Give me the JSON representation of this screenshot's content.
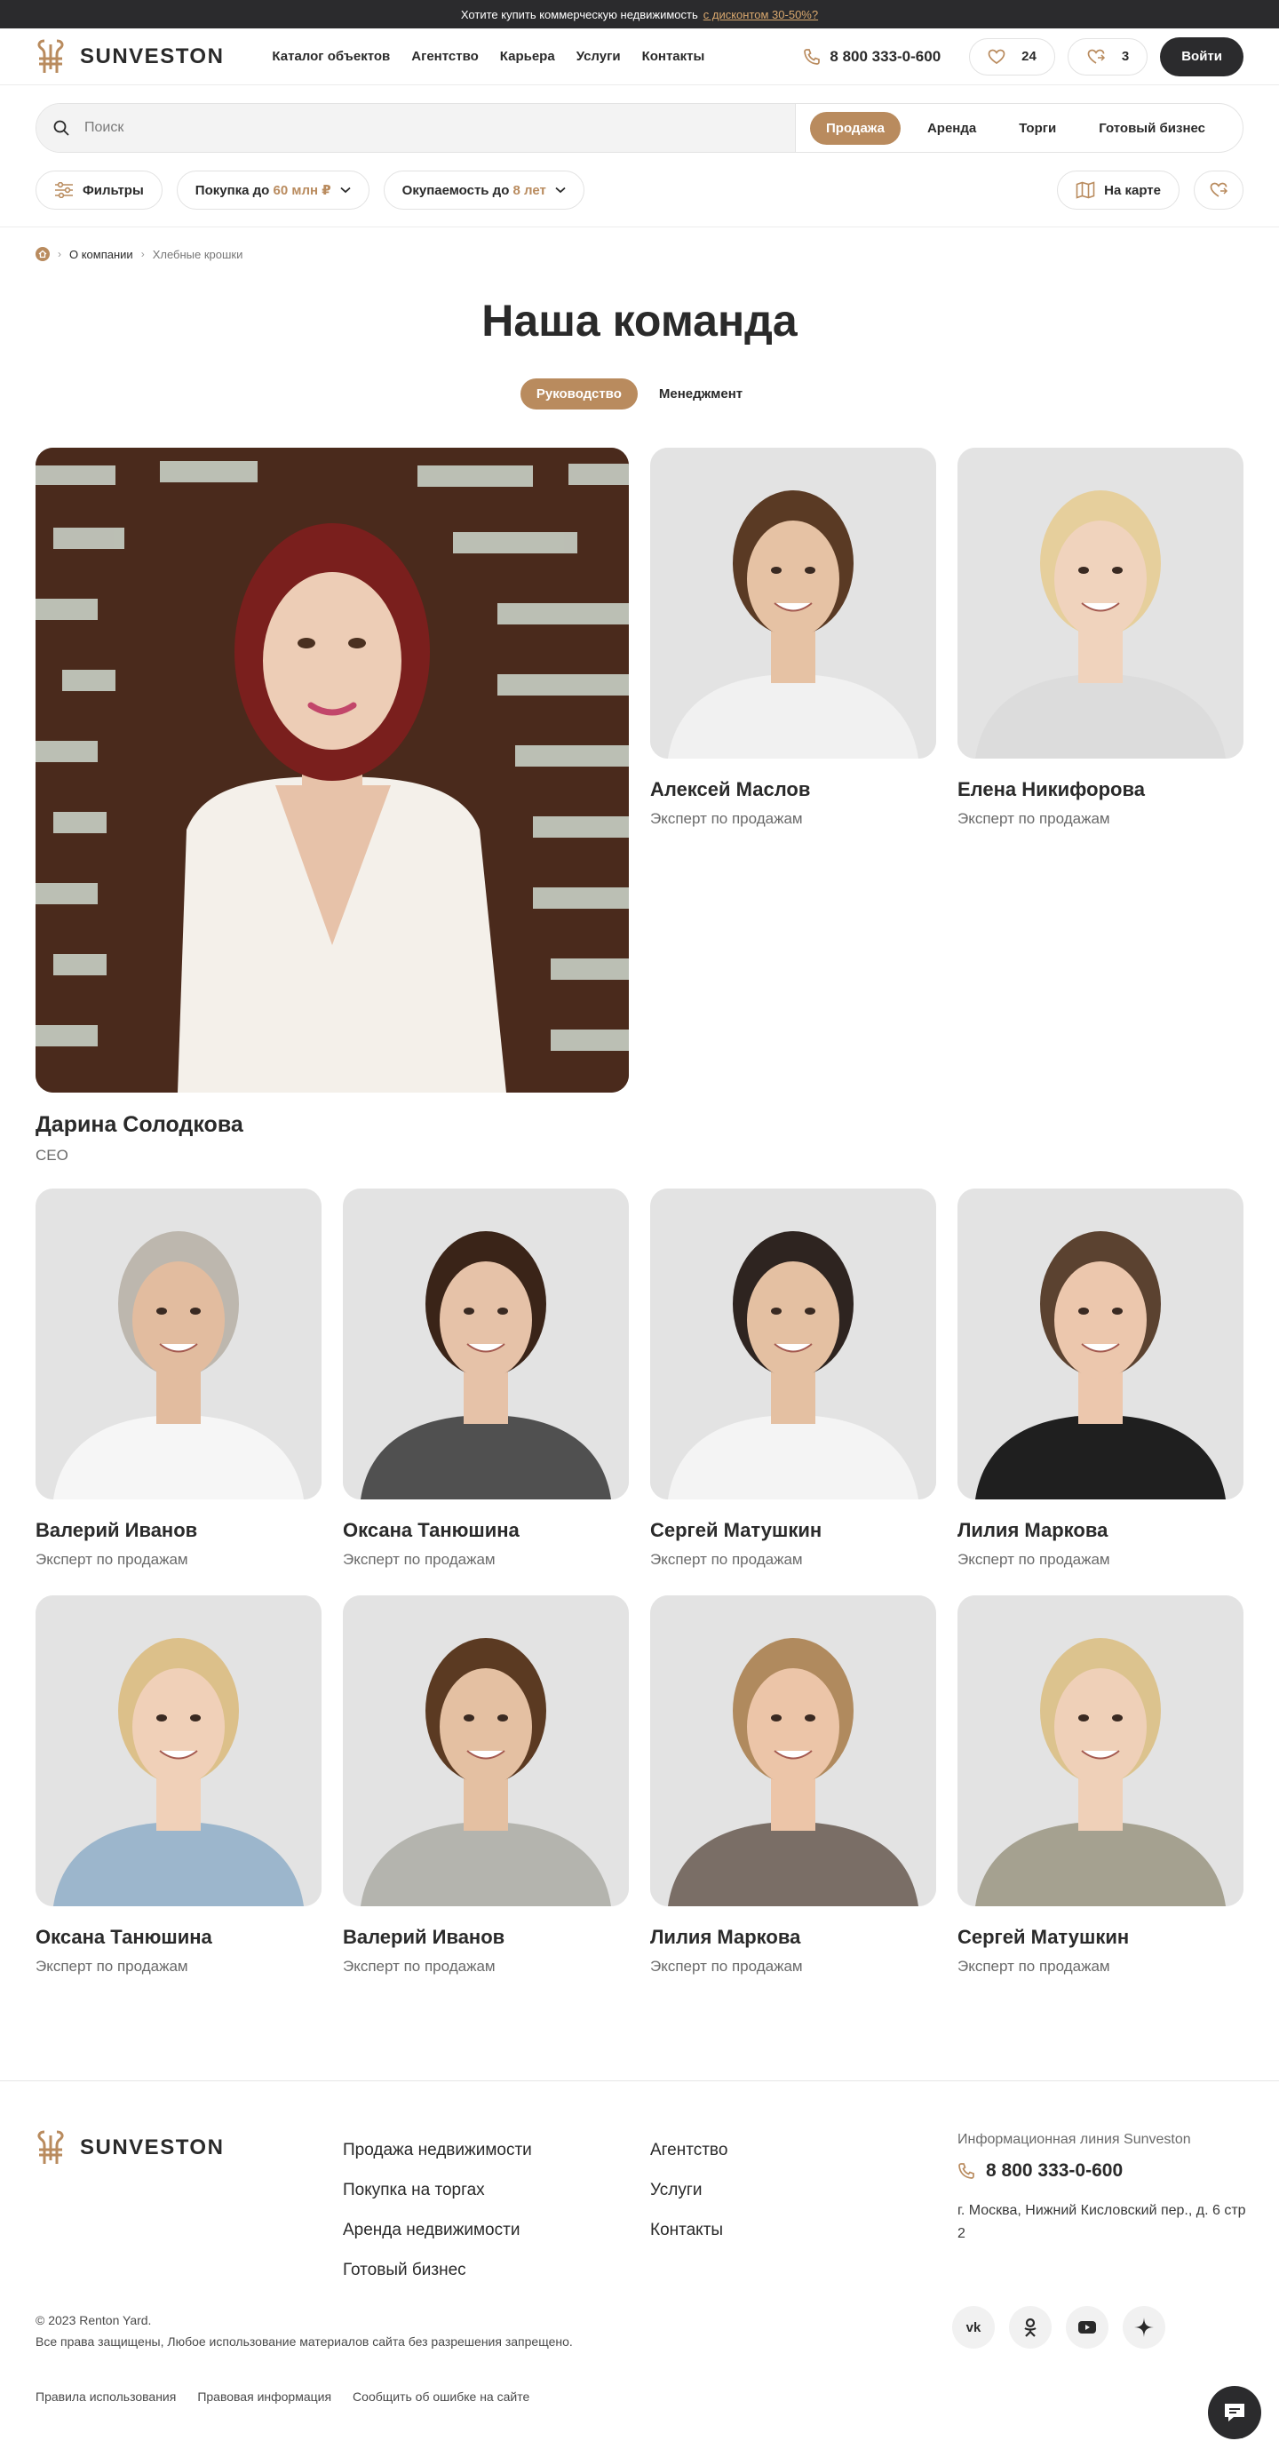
{
  "promo": {
    "text": "Хотите купить коммерческую недвижимость",
    "link": "с дисконтом 30-50%?"
  },
  "header": {
    "brand": "SUNVESTON",
    "nav": [
      "Каталог объектов",
      "Агентство",
      "Карьера",
      "Услуги",
      "Контакты"
    ],
    "phone": "8 800 333-0-600",
    "favorites_count": "24",
    "compare_count": "3",
    "login_label": "Войти"
  },
  "search": {
    "placeholder": "Поиск",
    "tabs": [
      "Продажа",
      "Аренда",
      "Торги",
      "Готовый бизнес"
    ],
    "active_tab": "Продажа"
  },
  "filters": {
    "filters_label": "Фильтры",
    "purchase_prefix": "Покупка до",
    "purchase_value": "60 млн ₽",
    "payback_prefix": "Окупаемость до",
    "payback_value": "8 лет",
    "map_label": "На карте"
  },
  "breadcrumbs": [
    "О компании",
    "Хлебные крошки"
  ],
  "page": {
    "title": "Наша команда",
    "tabs": [
      "Руководство",
      "Менеджмент"
    ],
    "active_tab": "Руководство"
  },
  "team": [
    {
      "name": "Дарина Солодкова",
      "role": "CEO"
    },
    {
      "name": "Алексей Маслов",
      "role": "Эксперт по продажам"
    },
    {
      "name": "Елена Никифорова",
      "role": "Эксперт по продажам"
    },
    {
      "name": "Валерий Иванов",
      "role": "Эксперт по продажам"
    },
    {
      "name": "Оксана Танюшина",
      "role": "Эксперт по продажам"
    },
    {
      "name": "Сергей Матушкин",
      "role": "Эксперт по продажам"
    },
    {
      "name": "Лилия Маркова",
      "role": "Эксперт по продажам"
    },
    {
      "name": "Оксана Танюшина",
      "role": "Эксперт по продажам"
    },
    {
      "name": "Валерий Иванов",
      "role": "Эксперт по продажам"
    },
    {
      "name": "Лилия Маркова",
      "role": "Эксперт по продажам"
    },
    {
      "name": "Сергей Матушкин",
      "role": "Эксперт по продажам"
    }
  ],
  "footer": {
    "brand": "SUNVESTON",
    "links_col1": [
      "Продажа недвижимости",
      "Покупка на торгах",
      "Аренда недвижимости",
      "Готовый бизнес"
    ],
    "links_col2": [
      "Агентство",
      "Услуги",
      "Контакты"
    ],
    "hotline_label": "Информационная линия Sunveston",
    "phone": "8 800 333-0-600",
    "address": "г. Москва, Нижний Кисловский пер., д. 6 стр 2",
    "copyright_line1": "© 2023 Renton Yard.",
    "copyright_line2": "Все права защищены, Любое использование материалов сайта без разрешения запрещено.",
    "legal_links": [
      "Правила использования",
      "Правовая информация",
      "Сообщить об ошибке на сайте"
    ],
    "socials": [
      "vk-icon",
      "ok-icon",
      "youtube-icon",
      "zen-icon"
    ]
  },
  "colors": {
    "accent": "#b98b5e",
    "dark": "#2b2b2d"
  }
}
